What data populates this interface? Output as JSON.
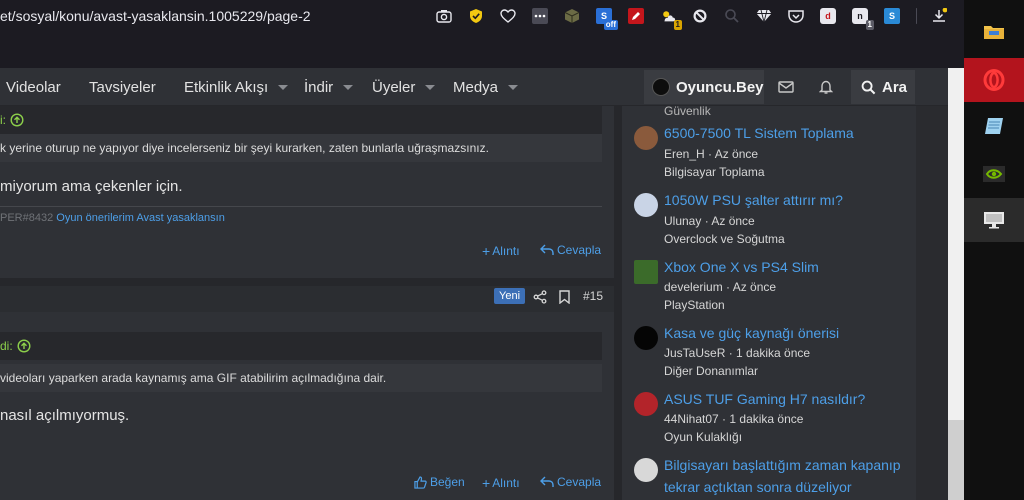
{
  "browser": {
    "url": "et/sosyal/konu/avast-yasaklansin.1005229/page-2",
    "ext_badges": {
      "sih": "off",
      "n_count": "1",
      "extra_count": "1"
    }
  },
  "nav": {
    "items": [
      {
        "label": "Videolar",
        "caret": false
      },
      {
        "label": "Tavsiyeler",
        "caret": false
      },
      {
        "label": "Etkinlik Akışı",
        "caret": true
      },
      {
        "label": "İndir",
        "caret": true
      },
      {
        "label": "Üyeler",
        "caret": true
      },
      {
        "label": "Medya",
        "caret": true
      }
    ],
    "username": "Oyuncu.Bey",
    "search_label": "Ara"
  },
  "posts": {
    "post1": {
      "quote_head": "i:",
      "quote_text": "k yerine oturup ne yapıyor diye incelerseniz bir şeyi kurarken, zaten bunlarla uğraşmazsınız.",
      "text": "miyorum ama çekenler için.",
      "sig_prefix": "PER#8432",
      "sig_link1": "Oyun önerilerim",
      "sig_link2": "Avast yasaklansın",
      "quote_action": "Alıntı",
      "reply_action": "Cevapla"
    },
    "post2": {
      "badge": "Yeni",
      "number": "#15",
      "quote_head": "di:",
      "quote_text": "videoları yaparken arada kaynamış ama GIF atabilirim açılmadığına dair.",
      "text": "nasıl açılmıyormuş.",
      "like_action": "Beğen",
      "quote_action": "Alıntı",
      "reply_action": "Cevapla"
    }
  },
  "sidebar": {
    "top_partial": "Güvenlik",
    "items": [
      {
        "title": "6500-7500 TL Sistem Toplama",
        "title2": "",
        "user": "Eren_H",
        "time": "Az önce",
        "category": "Bilgisayar Toplama",
        "avatar_color": "#8a5a3c"
      },
      {
        "title": "1050W PSU şalter attırır mı?",
        "title2": "",
        "user": "Ulunay",
        "time": "Az önce",
        "category": "Overclock ve Soğutma",
        "avatar_color": "#c9d4e6"
      },
      {
        "title": "Xbox One X vs PS4 Slim",
        "title2": "",
        "user": "develerium",
        "time": "Az önce",
        "category": "PlayStation",
        "avatar_color": "#3b6b2a"
      },
      {
        "title": "Kasa ve güç kaynağı önerisi",
        "title2": "",
        "user": "JusTaUseR",
        "time": "1 dakika önce",
        "category": "Diğer Donanımlar",
        "avatar_color": "#050505"
      },
      {
        "title": "ASUS TUF Gaming H7 nasıldır?",
        "title2": "",
        "user": "44Nihat07",
        "time": "1 dakika önce",
        "category": "Oyun Kulaklığı",
        "avatar_color": "#b3242a"
      },
      {
        "title": "Bilgisayarı başlattığım zaman kapanıp",
        "title2": "tekrar açtıktan sonra düzeliyor",
        "user": "",
        "time": "",
        "category": "",
        "avatar_color": "#d8d8d8"
      }
    ]
  },
  "colors": {
    "link": "#4d9fe8",
    "accent_green": "#8dd04b",
    "badge_blue": "#3c6fb6",
    "opera_red": "#b3141d"
  }
}
